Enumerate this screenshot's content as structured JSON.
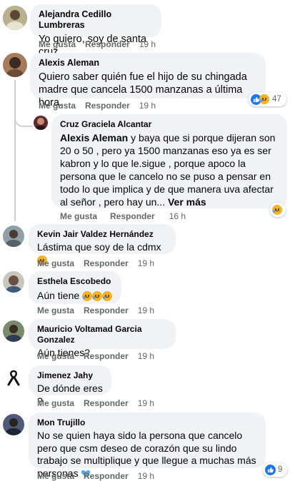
{
  "like_label": "Me gusta",
  "reply_label": "Responder",
  "comments": [
    {
      "author": "Alejandra Cedillo Lumbreras",
      "text": "Yo quiero, soy de santa cruz",
      "time": "19 h"
    },
    {
      "author": "Alexis Aleman",
      "text": "Quiero saber quién fue el hijo de su chingada madre que cancela 1500 manzanas a última hora.",
      "time": "19 h",
      "reaction_count": "47"
    },
    {
      "author": "Cruz Graciela Alcantar",
      "mention": "Alexis Aleman",
      "text": " y baya que si porque dijeran son 20 o 50 , pero ya 1500 manzanas eso ya es ser kabron y lo que le.sigue , porque apoco la persona que le cancelo no se puso a pensar en todo lo que implica y de que manera uva afectar al señor , pero hay un...",
      "see_more": "Ver más",
      "time": "16 h"
    },
    {
      "author": "Kevin Jair Valdez Hernández",
      "text": "Lástima que soy de la cdmx",
      "time": "19 h"
    },
    {
      "author": "Esthela Escobedo",
      "text": "Aún tiene",
      "time": "19 h"
    },
    {
      "author": "Mauricio Voltamad Garcia Gonzalez",
      "text": "Aún tienes?",
      "time": "19 h"
    },
    {
      "author": "Jimenez Jahy",
      "text": "De dónde eres ?",
      "time": "19 h"
    },
    {
      "author": "Mon Trujillo",
      "text": "No se quien haya sido la persona que cancelo pero que csm deseo de corazón que su lindo trabajo se multiplique y que llegue a muchas más personas",
      "time": "19 h",
      "reaction_count": "9"
    }
  ],
  "colors": {
    "bubble": "#f0f2f5",
    "meta": "#65676b",
    "like_blue": "#1877f2",
    "heart_blue": "#5aa9e6"
  }
}
